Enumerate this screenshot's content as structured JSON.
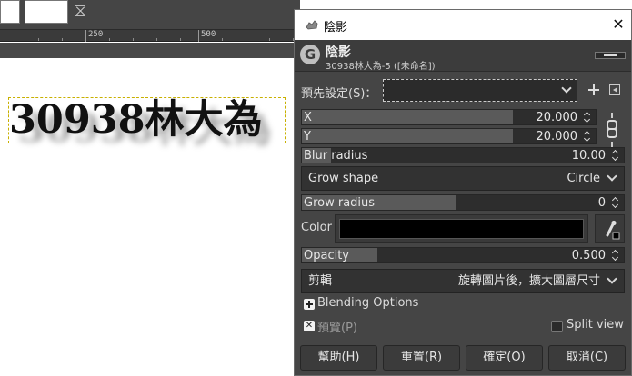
{
  "canvas": {
    "ruler_marks": [
      "250",
      "500"
    ],
    "text": "30938林大為"
  },
  "dialog": {
    "title": "陰影",
    "close_glyph": "✕",
    "header": {
      "logo_letter": "G",
      "title": "陰影",
      "subtitle": "30938林大為-5 ([未命名])"
    },
    "presets": {
      "label": "預先設定(S)：",
      "value": ""
    },
    "x": {
      "label": "X",
      "value": "20.000"
    },
    "y": {
      "label": "Y",
      "value": "20.000"
    },
    "blur_radius": {
      "label": "Blur radius",
      "value": "10.00"
    },
    "grow_shape": {
      "label": "Grow shape",
      "value": "Circle"
    },
    "grow_radius": {
      "label": "Grow radius",
      "value": "0"
    },
    "color": {
      "label": "Color",
      "value": "#000000"
    },
    "opacity": {
      "label": "Opacity",
      "value": "0.500"
    },
    "clipping": {
      "label": "剪輯",
      "value": "旋轉圖片後，擴大圖層尺寸"
    },
    "blending": {
      "label": "Blending Options"
    },
    "preview": {
      "label": "預覽(P)",
      "checked": true
    },
    "split_view": {
      "label": "Split view",
      "checked": false
    },
    "buttons": {
      "help": "幫助(H)",
      "reset": "重置(R)",
      "ok": "確定(O)",
      "cancel": "取消(C)"
    }
  },
  "colors": {
    "dialog_bg": "#454545",
    "selection_dash": "#c8b000",
    "slider_fill": "#5a5a5a"
  }
}
